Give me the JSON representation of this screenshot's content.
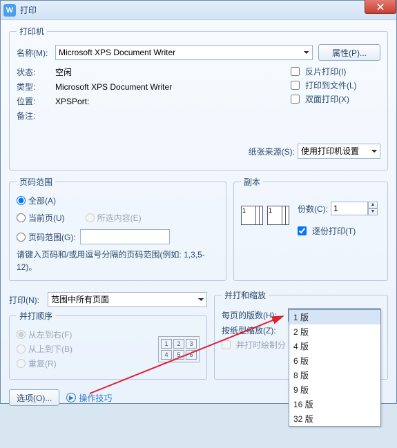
{
  "title": "打印",
  "printer": {
    "legend": "打印机",
    "name_lbl": "名称(M):",
    "name_val": "Microsoft XPS Document Writer",
    "prop_btn": "属性(P)...",
    "status_lbl": "状态:",
    "status_val": "空闲",
    "type_lbl": "类型:",
    "type_val": "Microsoft XPS Document Writer",
    "where_lbl": "位置:",
    "where_val": "XPSPort:",
    "comment_lbl": "备注:",
    "reverse": "反片打印(I)",
    "tofile": "打印到文件(L)",
    "duplex": "双面打印(X)",
    "papersrc_lbl": "纸张来源(S):",
    "papersrc_val": "使用打印机设置"
  },
  "range": {
    "legend": "页码范围",
    "all": "全部(A)",
    "current": "当前页(U)",
    "selection": "所选内容(E)",
    "pages": "页码范围(G):",
    "hint": "请键入页码和/或用逗号分隔的页码范围(例如: 1,3,5-12)。"
  },
  "copies": {
    "legend": "副本",
    "count_lbl": "份数(C):",
    "count_val": "1",
    "collate": "逐份打印(T)"
  },
  "print_sel": {
    "lbl": "打印(N):",
    "val": "范围中所有页面"
  },
  "order": {
    "legend": "并打顺序",
    "lr": "从左到右(F)",
    "tb": "从上到下(B)",
    "rep": "重复(R)"
  },
  "scale": {
    "legend": "并打和缩放",
    "pps_lbl": "每页的版数(H):",
    "pps_val": "1 版",
    "opts": [
      "1 版",
      "2 版",
      "4 版",
      "6 版",
      "8 版",
      "9 版",
      "16 版",
      "32 版"
    ],
    "paper_lbl": "按纸型缩放(Z):",
    "custom": "并打时绘制分"
  },
  "footer": {
    "options": "选项(O)...",
    "tips": "操作技巧"
  }
}
